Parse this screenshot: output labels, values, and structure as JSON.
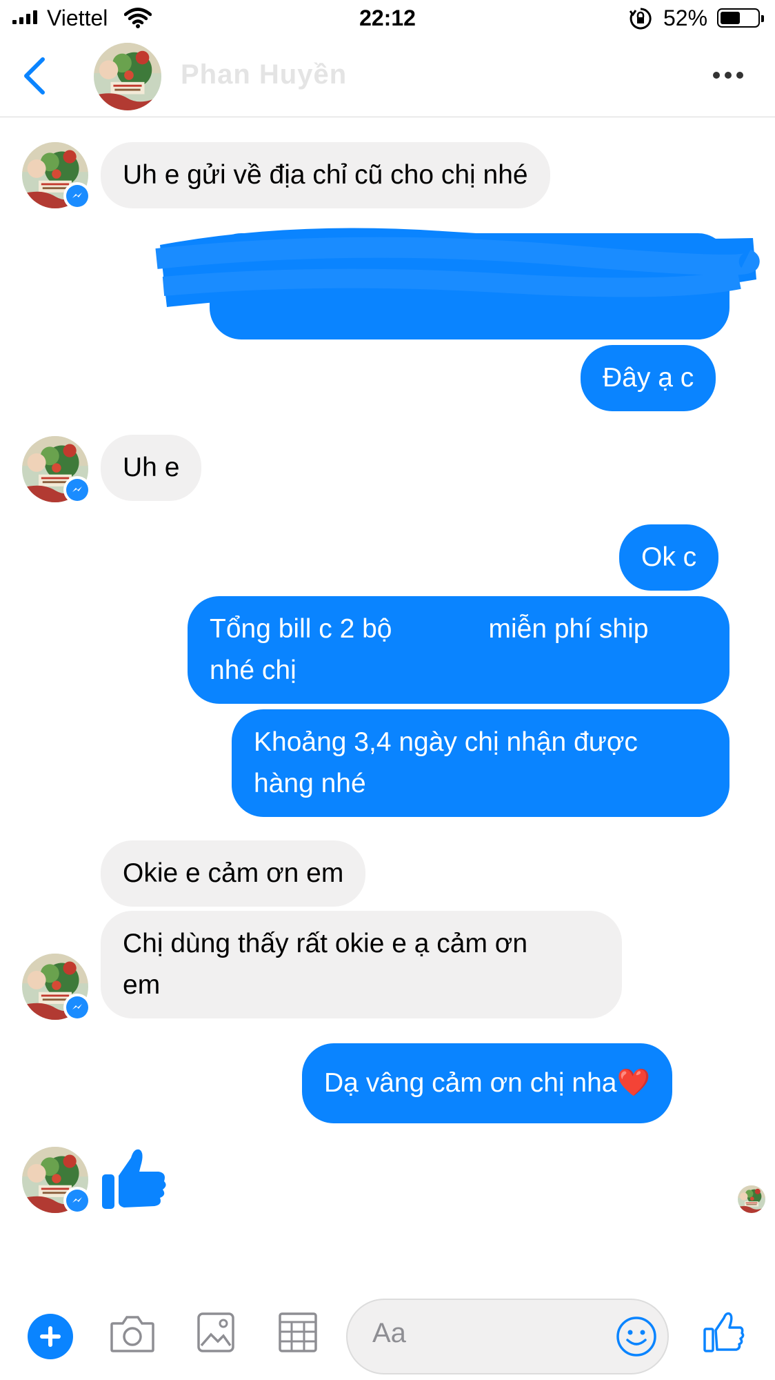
{
  "status_bar": {
    "carrier": "Viettel",
    "time": "22:12",
    "battery": "52%",
    "battery_level": 0.52
  },
  "header": {
    "contact_name": "Phan Huyền"
  },
  "messages": [
    {
      "from": "contact",
      "text": "Uh e gửi về địa chỉ cũ cho chị nhé"
    },
    {
      "from": "me",
      "text": "",
      "note": "redacted"
    },
    {
      "from": "me",
      "text": "Đây ạ c"
    },
    {
      "from": "contact",
      "text": "Uh e"
    },
    {
      "from": "me",
      "text": "Ok c"
    },
    {
      "from": "me",
      "text_line1_a": "Tổng bill c 2 bộ",
      "text_line1_b": "miễn phí ship",
      "text_line2": "nhé chị"
    },
    {
      "from": "me",
      "text_line1": "Khoảng 3,4 ngày chị nhận được",
      "text_line2": "hàng nhé"
    },
    {
      "from": "contact",
      "text": "Okie e cảm ơn em"
    },
    {
      "from": "contact",
      "text_line1": "Chị dùng thấy rất okie e ạ cảm ơn",
      "text_line2": "em"
    },
    {
      "from": "me",
      "text": "Dạ vâng cảm ơn chị nha",
      "emoji": "❤️"
    },
    {
      "from": "contact",
      "sticker": "thumbs-up"
    }
  ],
  "composer": {
    "placeholder": "Aa"
  },
  "icons": {
    "back": "chevron-left-icon",
    "more": "more-icon",
    "plus": "plus-icon",
    "camera": "camera-icon",
    "image": "image-icon",
    "grid": "grid-icon",
    "emoji": "emoji-icon",
    "like": "thumbs-up-icon"
  },
  "colors": {
    "accent": "#0a84ff",
    "incoming_bubble": "#f1f0f0",
    "outgoing_bubble": "#0a84ff"
  }
}
